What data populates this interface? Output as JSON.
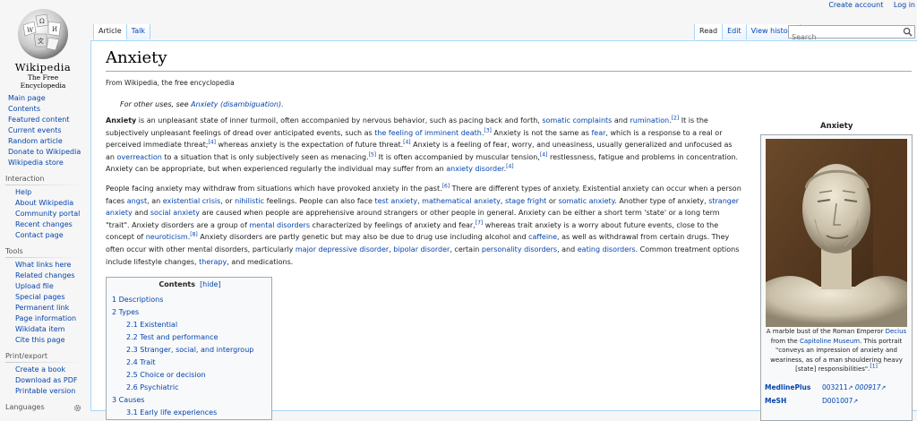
{
  "logo": {
    "wordmark": "Wikipedia",
    "tagline": "The Free Encyclopedia"
  },
  "sidebar": {
    "nav": [
      "Main page",
      "Contents",
      "Featured content",
      "Current events",
      "Random article",
      "Donate to Wikipedia",
      "Wikipedia store"
    ],
    "interaction": {
      "heading": "Interaction",
      "items": [
        "Help",
        "About Wikipedia",
        "Community portal",
        "Recent changes",
        "Contact page"
      ]
    },
    "tools": {
      "heading": "Tools",
      "items": [
        "What links here",
        "Related changes",
        "Upload file",
        "Special pages",
        "Permanent link",
        "Page information",
        "Wikidata item",
        "Cite this page"
      ]
    },
    "print": {
      "heading": "Print/export",
      "items": [
        "Create a book",
        "Download as PDF",
        "Printable version"
      ]
    },
    "languages": {
      "heading": "Languages"
    }
  },
  "personal": {
    "create_account": "Create account",
    "login": "Log in"
  },
  "tabs": {
    "article": "Article",
    "talk": "Talk",
    "read": "Read",
    "edit": "Edit",
    "history": "View history"
  },
  "search": {
    "placeholder": "Search"
  },
  "article": {
    "title": "Anxiety",
    "tagline": "From Wikipedia, the free encyclopedia",
    "hatnote_prefix": "For other uses, see ",
    "hatnote_link": "Anxiety (disambiguation)",
    "hatnote_suffix": "."
  },
  "p1": {
    "a": "Anxiety",
    "b": " is an unpleasant state of inner turmoil, often accompanied by nervous behavior, such as pacing back and forth, ",
    "l1": "somatic complaints",
    "c": " and ",
    "l2": "rumination",
    "r1": "[2]",
    "d": " It is the subjectively unpleasant feelings of dread over anticipated events, such as ",
    "l3": "the feeling of imminent death",
    "r2": "[3]",
    "e": " Anxiety is not the same as ",
    "l4": "fear",
    "f": ", which is a response to a real or perceived immediate threat;",
    "r3": "[4]",
    "g": " whereas anxiety is the expectation of future threat.",
    "r4": "[4]",
    "h": " Anxiety is a feeling of fear, worry, and uneasiness, usually generalized and unfocused as an ",
    "l5": "overreaction",
    "i": " to a situation that is only subjectively seen as menacing.",
    "r5": "[5]",
    "j": " It is often accompanied by muscular tension,",
    "r6": "[4]",
    "k": " restlessness, fatigue and problems in concentration. Anxiety can be appropriate, but when experienced regularly the individual may suffer from an ",
    "l6": "anxiety disorder",
    "r7": "[4]"
  },
  "p2": {
    "a": "People facing anxiety may withdraw from situations which have provoked anxiety in the past.",
    "r1": "[6]",
    "b": " There are different types of anxiety. Existential anxiety can occur when a person faces ",
    "l1": "angst",
    "c": ", an ",
    "l2": "existential crisis",
    "d": ", or ",
    "l3": "nihilistic",
    "e": " feelings. People can also face ",
    "l4": "test anxiety",
    "f": ", ",
    "l5": "mathematical anxiety",
    "g": ", ",
    "l6": "stage fright",
    "h": " or ",
    "l7": "somatic anxiety",
    "i": ". Another type of anxiety, ",
    "l8": "stranger anxiety",
    "j": " and ",
    "l9": "social anxiety",
    "k": " are caused when people are apprehensive around strangers or other people in general. Anxiety can be either a short term 'state' or a long term \"trait\". Anxiety disorders are a group of ",
    "l10": "mental disorders",
    "l": " characterized by feelings of anxiety and fear,",
    "r2": "[7]",
    "m": " whereas trait anxiety is a worry about future events, close to the concept of ",
    "l11": "neuroticism",
    "r3": "[8]",
    "n": " Anxiety disorders are partly genetic but may also be due to drug use including alcohol and ",
    "l12": "caffeine",
    "o": ", as well as withdrawal from certain drugs. They often occur with other mental disorders, particularly ",
    "l13": "major depressive disorder",
    "p": ", ",
    "l14": "bipolar disorder",
    "q": ", certain ",
    "l15": "personality disorders",
    "s": ", and ",
    "l16": "eating disorders",
    "t": ". Common treatment options include lifestyle changes, ",
    "l17": "therapy",
    "u": ", and medications."
  },
  "toc": {
    "title": "Contents",
    "hide": "[hide]",
    "items": [
      "1 Descriptions",
      "2 Types",
      "2.1 Existential",
      "2.2 Test and performance",
      "2.3 Stranger, social, and intergroup",
      "2.4 Trait",
      "2.5 Choice or decision",
      "2.6 Psychiatric",
      "3 Causes",
      "3.1 Early life experiences"
    ]
  },
  "infobox": {
    "title": "Anxiety",
    "caption": {
      "a": "A marble bust of the Roman Emperor ",
      "l1": "Decius",
      "b": " from the ",
      "l2": "Capitoline Museum",
      "c": ". This portrait \"conveys an impression of anxiety and weariness, as of a man shouldering heavy [state] responsibilities\".",
      "r1": "[1]"
    },
    "medlineplus": {
      "label": "MedlinePlus",
      "v1": "003211",
      "v2": "000917"
    },
    "mesh": {
      "label": "MeSH",
      "v1": "D001007"
    }
  },
  "colors": {
    "link": "#0645ad",
    "tab_border": "#a7d7f9",
    "sidebar_bg": "#f6f6f6"
  },
  "icons": [
    "search-icon",
    "gear-icon",
    "external-link-icon",
    "globe-logo"
  ]
}
